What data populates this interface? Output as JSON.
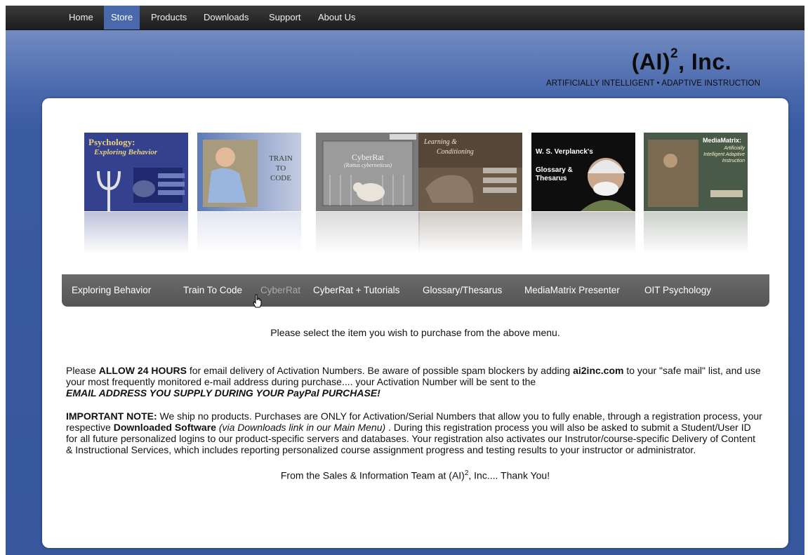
{
  "topnav": {
    "items": [
      {
        "label": "Home"
      },
      {
        "label": "Store"
      },
      {
        "label": "Products"
      },
      {
        "label": "Downloads"
      },
      {
        "label": "Support"
      },
      {
        "label": "About Us"
      }
    ]
  },
  "brand": {
    "name_main": "(AI)",
    "name_sup": "2",
    "name_tail": ", Inc.",
    "tagline": "ARTIFICIALLY INTELLIGENT • ADAPTIVE INSTRUCTION"
  },
  "covers": [
    {
      "title": "Psychology:",
      "subtitle": "Exploring Behavior"
    },
    {
      "title": "TRAIN",
      "subtitle": "TO",
      "extra": "CODE"
    },
    {
      "title": "CyberRat",
      "subtitle": "(Rattus cyberneticus)"
    },
    {
      "title": "Learning &",
      "subtitle": "Conditioning"
    },
    {
      "title": "W. S. Verplanck's",
      "subtitle": "Glossary &",
      "extra": "Thesarus"
    },
    {
      "title": "MediaMatrix:",
      "subtitle": "Artificially Intelligent Adaptive Instruction"
    }
  ],
  "product_menu": {
    "items": [
      {
        "label": "Exploring Behavior"
      },
      {
        "label": "Train To Code"
      },
      {
        "label": "CyberRat"
      },
      {
        "label": "CyberRat + Tutorials"
      },
      {
        "label": "Glossary/Thesarus"
      },
      {
        "label": "MediaMatrix Presenter"
      },
      {
        "label": "OIT Psychology"
      }
    ]
  },
  "content": {
    "select_prompt": "Please select the item you wish to purchase from the above menu.",
    "allow_pre": "Please ",
    "allow_bold": "ALLOW 24 HOURS",
    "allow_mid": " for email delivery of Activation Numbers. Be aware of possible spam blockers by adding ",
    "allow_domain": "ai2inc.com",
    "allow_post": " to your \"safe mail\" list, and use your most frequently monitored e-mail address during purchase.... your Activation Number will be sent to the",
    "allow_email": "EMAIL ADDRESS YOU SUPPLY DURING YOUR PayPal PURCHASE!",
    "note_bold": "IMPORTANT NOTE:",
    "note_a": " We ship no products. Purchases are ONLY for Activation/Serial Numbers that allow you to fully enable, through a registration process, your respective ",
    "note_software": "Downloaded Software",
    "note_italic": " (via Downloads link in our Main Menu)",
    "note_b": " . During this registration process you will also be asked to submit a Student/User ID for all future personalized logins to our product-specific servers and databases. Your registration also activates our Instrutor/course-specific Delivery of Content & Instructional Services, which includes reporting personalized course assignment progress and testing results to your instructor or administrator.",
    "thanks_pre": "From the Sales & Information Team at (AI)",
    "thanks_sup": "2",
    "thanks_post": ", Inc.... Thank You!"
  },
  "colors": {
    "background_blue": "#3a5aa2",
    "nav_dark": "#1d1d1d",
    "menu_gray": "#5d5d5d"
  }
}
